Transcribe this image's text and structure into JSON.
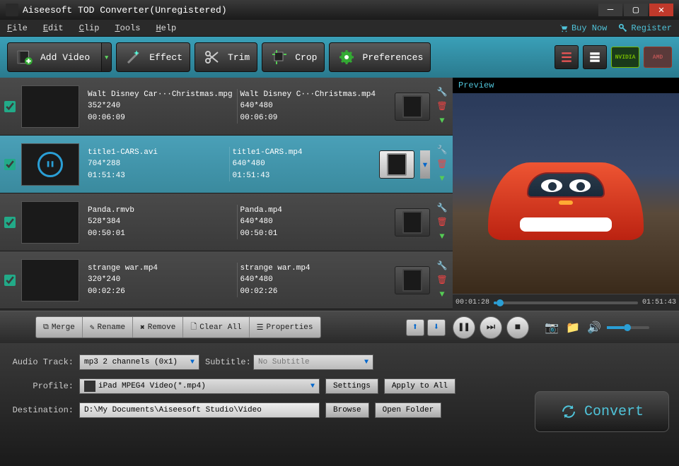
{
  "titlebar": {
    "title": "Aiseesoft TOD Converter(Unregistered)"
  },
  "menubar": {
    "items": [
      "File",
      "Edit",
      "Clip",
      "Tools",
      "Help"
    ],
    "buy": "Buy Now",
    "register": "Register"
  },
  "toolbar": {
    "add_video": "Add Video",
    "effect": "Effect",
    "trim": "Trim",
    "crop": "Crop",
    "preferences": "Preferences"
  },
  "files": [
    {
      "src_name": "Walt Disney Car···Christmas.mpg",
      "src_res": "352*240",
      "src_dur": "00:06:09",
      "out_name": "Walt Disney C···Christmas.mp4",
      "out_res": "640*480",
      "out_dur": "00:06:09",
      "selected": false
    },
    {
      "src_name": "title1-CARS.avi",
      "src_res": "704*288",
      "src_dur": "01:51:43",
      "out_name": "title1-CARS.mp4",
      "out_res": "640*480",
      "out_dur": "01:51:43",
      "selected": true
    },
    {
      "src_name": "Panda.rmvb",
      "src_res": "528*384",
      "src_dur": "00:50:01",
      "out_name": "Panda.mp4",
      "out_res": "640*480",
      "out_dur": "00:50:01",
      "selected": false
    },
    {
      "src_name": "strange war.mp4",
      "src_res": "320*240",
      "src_dur": "00:02:26",
      "out_name": "strange war.mp4",
      "out_res": "640*480",
      "out_dur": "00:02:26",
      "selected": false
    }
  ],
  "preview": {
    "label": "Preview",
    "time_cur": "00:01:28",
    "time_total": "01:51:43"
  },
  "list_actions": {
    "merge": "Merge",
    "rename": "Rename",
    "remove": "Remove",
    "clear_all": "Clear All",
    "properties": "Properties"
  },
  "settings": {
    "audio_track_label": "Audio Track:",
    "audio_track_value": "mp3 2 channels (0x1)",
    "subtitle_label": "Subtitle:",
    "subtitle_value": "No Subtitle",
    "profile_label": "Profile:",
    "profile_value": "iPad MPEG4 Video(*.mp4)",
    "settings_btn": "Settings",
    "apply_all_btn": "Apply to All",
    "destination_label": "Destination:",
    "destination_value": "D:\\My Documents\\Aiseesoft Studio\\Video",
    "browse_btn": "Browse",
    "open_folder_btn": "Open Folder"
  },
  "convert": "Convert"
}
